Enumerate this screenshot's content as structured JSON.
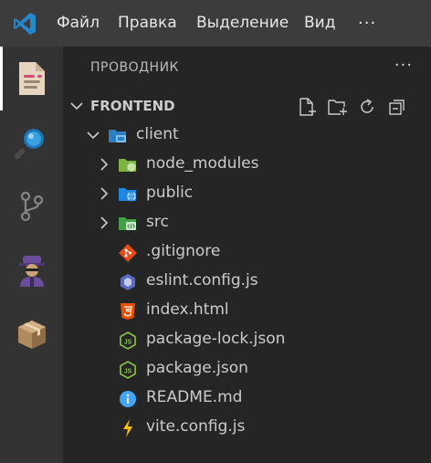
{
  "menu": {
    "items": [
      "Файл",
      "Правка",
      "Выделение",
      "Вид"
    ],
    "more": "···"
  },
  "activity": [
    "explorer-icon",
    "search-icon",
    "source-control-icon",
    "agent-icon",
    "extensions-box-icon"
  ],
  "sidebar": {
    "title": "ПРОВОДНИК",
    "more": "···",
    "section": {
      "title": "FRONTEND",
      "actions": [
        "new-file-icon",
        "new-folder-icon",
        "refresh-icon",
        "collapse-all-icon"
      ]
    },
    "tree": [
      {
        "label": "client",
        "type": "folder-open",
        "depth": 1,
        "icon": "client-folder-icon"
      },
      {
        "label": "node_modules",
        "type": "folder",
        "depth": 2,
        "icon": "node-modules-folder-icon"
      },
      {
        "label": "public",
        "type": "folder",
        "depth": 2,
        "icon": "public-folder-icon"
      },
      {
        "label": "src",
        "type": "folder",
        "depth": 2,
        "icon": "src-folder-icon"
      },
      {
        "label": ".gitignore",
        "type": "file",
        "depth": 2,
        "icon": "git-icon"
      },
      {
        "label": "eslint.config.js",
        "type": "file",
        "depth": 2,
        "icon": "eslint-icon"
      },
      {
        "label": "index.html",
        "type": "file",
        "depth": 2,
        "icon": "html5-icon"
      },
      {
        "label": "package-lock.json",
        "type": "file",
        "depth": 2,
        "icon": "nodejs-icon"
      },
      {
        "label": "package.json",
        "type": "file",
        "depth": 2,
        "icon": "nodejs-icon"
      },
      {
        "label": "README.md",
        "type": "file",
        "depth": 2,
        "icon": "info-icon"
      },
      {
        "label": "vite.config.js",
        "type": "file",
        "depth": 2,
        "icon": "vite-icon"
      }
    ]
  },
  "colors": {
    "titlebar": "#3c3c3c",
    "activitybar": "#333333",
    "sidebar": "#252526",
    "accent": "#007acc"
  }
}
